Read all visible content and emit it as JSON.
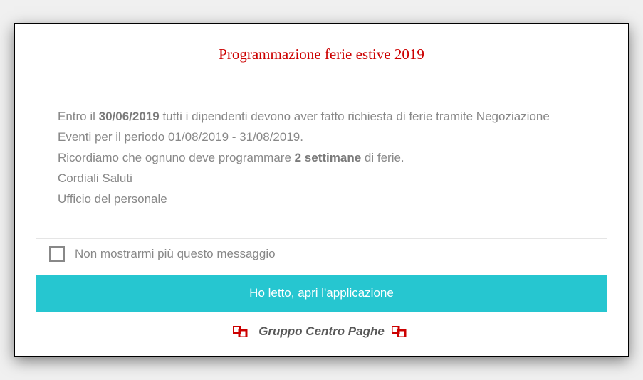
{
  "modal": {
    "title": "Programmazione ferie estive 2019",
    "body": {
      "line1_pre": "Entro il ",
      "line1_bold": "30/06/2019",
      "line1_post": " tutti i dipendenti devono aver fatto richiesta di ferie tramite Negoziazione Eventi per il periodo 01/08/2019 - 31/08/2019.",
      "line2_pre": "Ricordiamo che ognuno deve programmare ",
      "line2_bold": "2 settimane",
      "line2_post": " di ferie.",
      "line3": "Cordiali Saluti",
      "line4": "Ufficio del personale"
    },
    "checkbox_label": "Non mostrarmi più questo messaggio",
    "button_label": "Ho letto, apri l'applicazione",
    "logo_text": "Gruppo Centro Paghe"
  },
  "colors": {
    "title": "#cc0000",
    "button_bg": "#26c6d0",
    "text_muted": "#888888"
  }
}
